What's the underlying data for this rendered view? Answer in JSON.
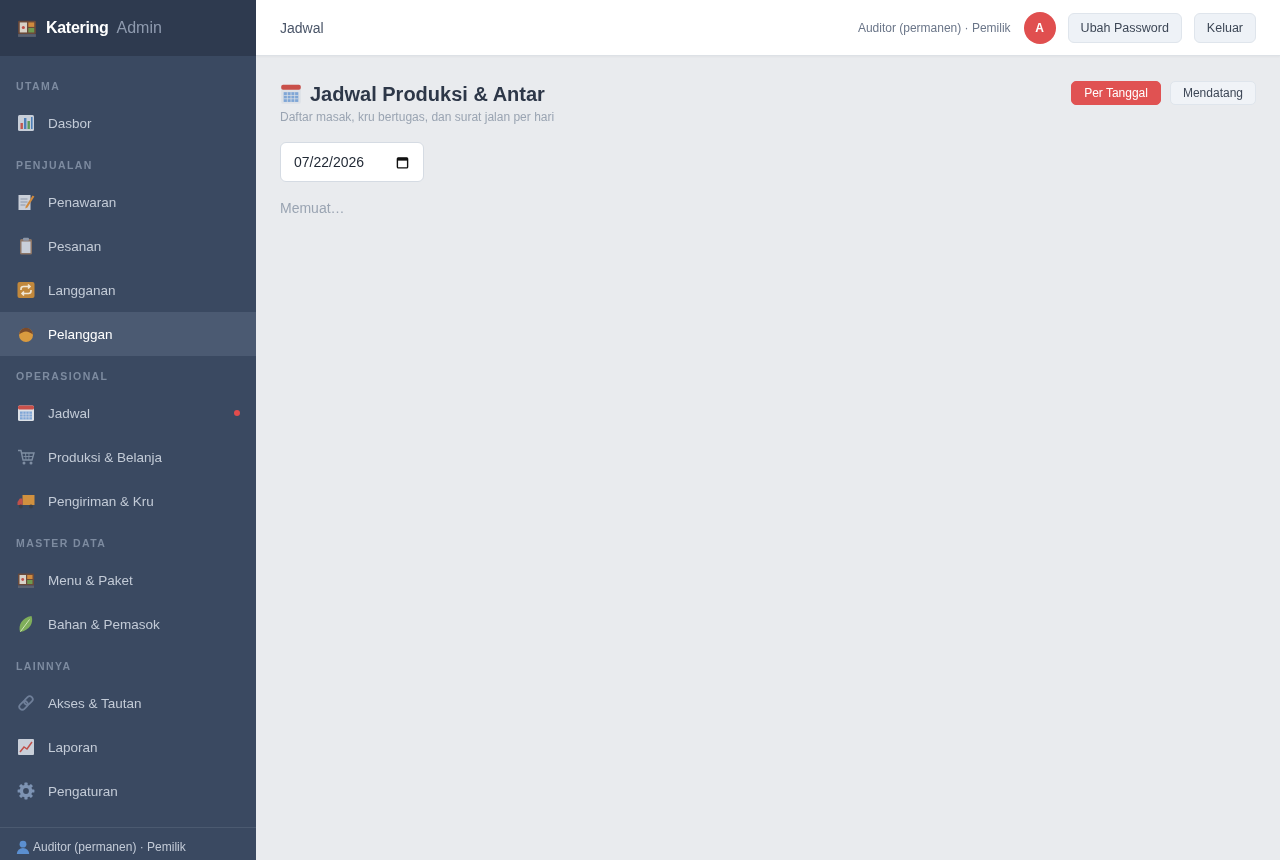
{
  "brand": {
    "name": "Katering",
    "suffix": "Admin"
  },
  "sidebar": {
    "sections": [
      {
        "label": "UTAMA",
        "items": [
          {
            "label": "Dasbor",
            "selected": false,
            "notification": false
          }
        ]
      },
      {
        "label": "PENJUALAN",
        "items": [
          {
            "label": "Penawaran",
            "selected": false,
            "notification": false
          },
          {
            "label": "Pesanan",
            "selected": false,
            "notification": false
          },
          {
            "label": "Langganan",
            "selected": false,
            "notification": false
          },
          {
            "label": "Pelanggan",
            "selected": true,
            "notification": false
          }
        ]
      },
      {
        "label": "OPERASIONAL",
        "items": [
          {
            "label": "Jadwal",
            "selected": false,
            "notification": true
          },
          {
            "label": "Produksi & Belanja",
            "selected": false,
            "notification": false
          },
          {
            "label": "Pengiriman & Kru",
            "selected": false,
            "notification": false
          }
        ]
      },
      {
        "label": "MASTER DATA",
        "items": [
          {
            "label": "Menu & Paket",
            "selected": false,
            "notification": false
          },
          {
            "label": "Bahan & Pemasok",
            "selected": false,
            "notification": false
          }
        ]
      },
      {
        "label": "LAINNYA",
        "items": [
          {
            "label": "Akses & Tautan",
            "selected": false,
            "notification": false
          },
          {
            "label": "Laporan",
            "selected": false,
            "notification": false
          },
          {
            "label": "Pengaturan",
            "selected": false,
            "notification": false
          }
        ]
      }
    ],
    "footer": "Auditor (permanen) · Pemilik"
  },
  "header": {
    "title": "Jadwal",
    "user": "Auditor (permanen) · Pemilik",
    "avatar": "A",
    "buttons": [
      "Ubah Password",
      "Keluar"
    ]
  },
  "page": {
    "title": "Jadwal Produksi & Antar",
    "subtitle": "Daftar masak, kru bertugas, dan surat jalan per hari",
    "tabs": [
      {
        "label": "Per Tanggal",
        "selected": true
      },
      {
        "label": "Mendatang",
        "selected": false
      }
    ],
    "date": {
      "value": "07/22/2026"
    },
    "status": "Memuat…"
  }
}
